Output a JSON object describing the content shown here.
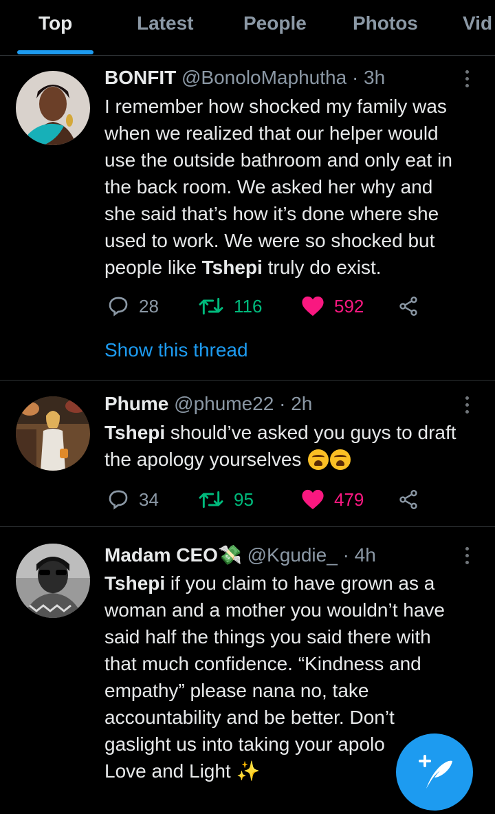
{
  "tabs": [
    {
      "label": "Top",
      "active": true
    },
    {
      "label": "Latest"
    },
    {
      "label": "People"
    },
    {
      "label": "Photos"
    },
    {
      "label": "Vid"
    }
  ],
  "tweets": [
    {
      "name": "BONFIT",
      "handle": "@BonoloMaphutha",
      "time": "3h",
      "text_lines": [
        "I remember how shocked my family was",
        "when we realized that our helper would",
        "use the outside bathroom and only eat in",
        "the back room. We asked her why and",
        "she said that’s how it’s done where she",
        "used to work. We were so shocked but"
      ],
      "last_line_prefix": "people like ",
      "last_line_bold": "Tshepi",
      "last_line_suffix": " truly do exist.",
      "replies": "28",
      "retweets": "116",
      "likes": "592",
      "show_thread": "Show this thread"
    },
    {
      "name": "Phume",
      "handle": "@phume22",
      "time": "2h",
      "first_bold": "Tshepi",
      "first_rest": " should’ve asked you guys to draft",
      "second_line": "the apology yourselves",
      "emoji": [
        "😩",
        "😩"
      ],
      "replies": "34",
      "retweets": "95",
      "likes": "479"
    },
    {
      "name": "Madam CEO",
      "name_emoji": "💸",
      "handle": "@Kgudie_",
      "time": "4h",
      "first_bold": "Tshepi",
      "first_rest": " if you claim to have grown as a",
      "text_lines": [
        "woman and a mother you wouldn’t have",
        "said half the things you said there with",
        "that much confidence. “Kindness and",
        "empathy” please nana no, take",
        "accountability and be better. Don’t",
        "gaslight us into taking your apolo",
        "Love and Light"
      ],
      "end_emoji": "✨"
    }
  ],
  "colors": {
    "accent": "#1d9bf0",
    "retweet": "#00ba7c",
    "like": "#f91880",
    "muted": "#8b98a5"
  },
  "icons": [
    "reply-icon",
    "retweet-icon",
    "heart-icon",
    "share-icon",
    "more-icon",
    "compose-tweet-icon"
  ]
}
